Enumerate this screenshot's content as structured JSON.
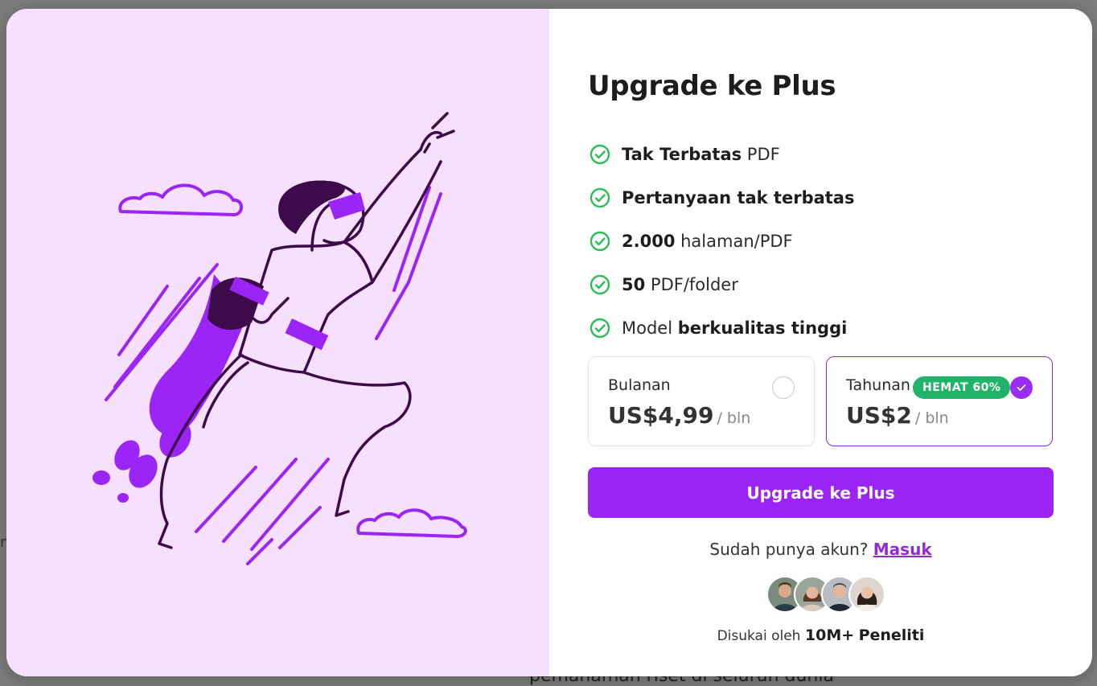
{
  "background": {
    "partial_text": "pemahaman riset di seluruh dunia",
    "edge_char": "nt"
  },
  "modal": {
    "title": "Upgrade ke Plus",
    "features": [
      {
        "bold": "Tak Terbatas",
        "rest": " PDF",
        "order": "bold-first"
      },
      {
        "bold": "Pertanyaan tak terbatas",
        "rest": "",
        "order": "bold-first"
      },
      {
        "bold": "2.000",
        "rest": " halaman/PDF",
        "order": "bold-first"
      },
      {
        "bold": "50",
        "rest": " PDF/folder",
        "order": "bold-first"
      },
      {
        "pre": "Model ",
        "bold": "berkualitas tinggi",
        "order": "normal-first"
      }
    ],
    "plans": {
      "monthly": {
        "name": "Bulanan",
        "price": "US$4,99",
        "unit": "/ bln",
        "selected": false
      },
      "yearly": {
        "name": "Tahunan",
        "badge": "HEMAT 60%",
        "price": "US$2",
        "unit": "/ bln",
        "selected": true
      }
    },
    "cta_label": "Upgrade ke Plus",
    "login": {
      "question": "Sudah punya akun?",
      "link": "Masuk"
    },
    "social": {
      "prefix": "Disukai oleh",
      "count": "10M+",
      "noun": "Peneliti"
    },
    "avatars": [
      "avatar-1",
      "avatar-2",
      "avatar-3",
      "avatar-4"
    ]
  },
  "colors": {
    "accent": "#9b24f7",
    "check": "#2ebd59",
    "badge": "#22b36a",
    "panel": "#f6e0fe",
    "ink": "#3d0a4a"
  }
}
